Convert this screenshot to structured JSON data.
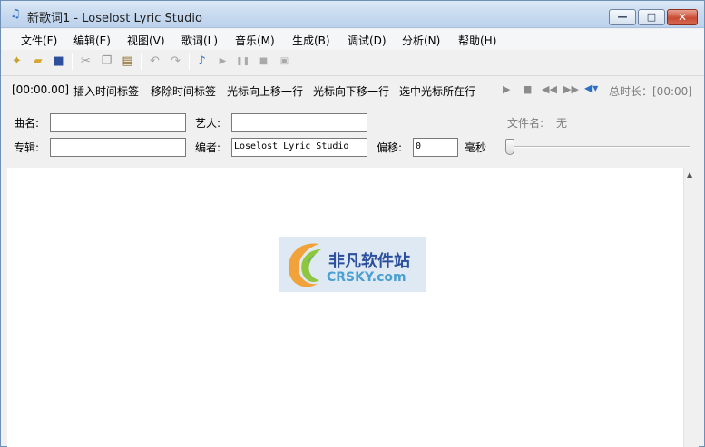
{
  "window": {
    "title": "新歌词1 - Loselost Lyric Studio",
    "minimize_glyph": "—",
    "maximize_glyph": "□",
    "close_glyph": "✕"
  },
  "menu": [
    "文件(F)",
    "编辑(E)",
    "视图(V)",
    "歌词(L)",
    "音乐(M)",
    "生成(B)",
    "调试(D)",
    "分析(N)",
    "帮助(H)"
  ],
  "toolbar": {
    "icons": [
      "new-file-icon",
      "open-folder-icon",
      "save-icon",
      "cut-icon",
      "copy-icon",
      "paste-icon",
      "undo-icon",
      "redo-icon",
      "music-note-icon",
      "play-icon",
      "pause-icon",
      "stop-icon",
      "record-icon"
    ]
  },
  "commands": {
    "time": "[00:00.00]",
    "insert": "插入时间标签",
    "remove": "移除时间标签",
    "cursor_up": "光标向上移一行",
    "cursor_down": "光标向下移一行",
    "select_line": "选中光标所在行",
    "total_length": "总时长：[00:00]"
  },
  "form": {
    "song_label": "曲名:",
    "song_value": "",
    "artist_label": "艺人:",
    "artist_value": "",
    "album_label": "专辑:",
    "album_value": "",
    "editor_label": "编者:",
    "editor_value": "Loselost Lyric Studio",
    "offset_label": "偏移:",
    "offset_value": "0",
    "offset_unit": "毫秒",
    "filename_label": "文件名:",
    "filename_value": "无"
  },
  "watermark": {
    "title": "非凡软件站",
    "subtitle": "CRSKY.com"
  },
  "colors": {
    "title_gradient": "#c5d8ee",
    "close_red": "#c94b33",
    "accent_blue": "#2f6ec2"
  }
}
